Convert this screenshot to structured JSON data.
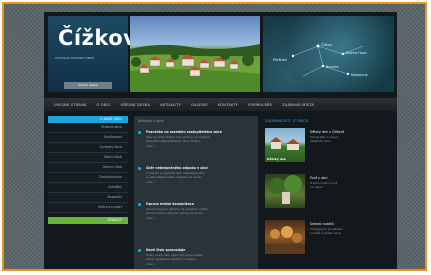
{
  "site": {
    "title": "Čížkov",
    "subtitle": "OFICIÁLNÍ STRÁNKY OBCE",
    "header_button": "Úřední deska"
  },
  "map": {
    "places": [
      "Čížkov",
      "Zelená Hora",
      "Přeštice",
      "Blovice",
      "Nepomuk"
    ]
  },
  "nav": {
    "items": [
      "ÚVODNÍ STRANA",
      "O OBCI",
      "ÚŘEDNÍ DESKA",
      "AKTUALITY",
      "GALERIE",
      "KONTAKTY",
      "FORMULÁŘE",
      "ZAJÍMAVÁ MÍSTA"
    ]
  },
  "sidebar": {
    "heading_1": "O NAŠÍ OBCI",
    "items_1": [
      "Historie obce",
      "Současnost",
      "Symboly obce",
      "Místní části",
      "Obecní úřad",
      "Zastupitelstvo",
      "Vyhlášky",
      "Rozpočet",
      "Kultura a sport"
    ],
    "heading_2": "ODKAZY"
  },
  "news": {
    "label": "Aktuality z obce",
    "items": [
      {
        "title": "Pozvánka na zasedání zastupitelstva obce",
        "line1": "Obecní úřad Čížkov zve občany na veřejné",
        "line2": "zasedání zastupitelstva obce Čížkov.",
        "more": "více »"
      },
      {
        "title": "Sběr nebezpečného odpadu v obci",
        "line1": "V sobotu proběhne sběr nebezpečného",
        "line2": "a velkoobjemového odpadu na návsi.",
        "more": "více »"
      },
      {
        "title": "Oprava místní komunikace",
        "line1": "Upozorňujeme občany na uzavírku místní",
        "line2": "komunikace z důvodu opravy povrchu.",
        "more": "více »"
      },
      {
        "title": "Nové číslo zpravodaje",
        "line1": "Vyšlo nové číslo obecního zpravodaje,",
        "line2": "které najdete ke stažení na webu.",
        "more": "více »"
      }
    ]
  },
  "gallery": {
    "heading": "ZAJÍMAVOSTI Z OBCE",
    "items": [
      {
        "title": "Dětský den v Čížkově",
        "d1": "Fotografie z oslavy",
        "d2": "dětského dne",
        "thumb_label": "Dětský den"
      },
      {
        "title": "Pouť v obci",
        "d1": "Tradiční letní pouť",
        "d2": "na návsi",
        "thumb_label": ""
      },
      {
        "title": "Setkání rodáků",
        "d1": "Fotogalerie ze setkání",
        "d2": "rodáků a přátel obce",
        "thumb_label": ""
      }
    ]
  }
}
